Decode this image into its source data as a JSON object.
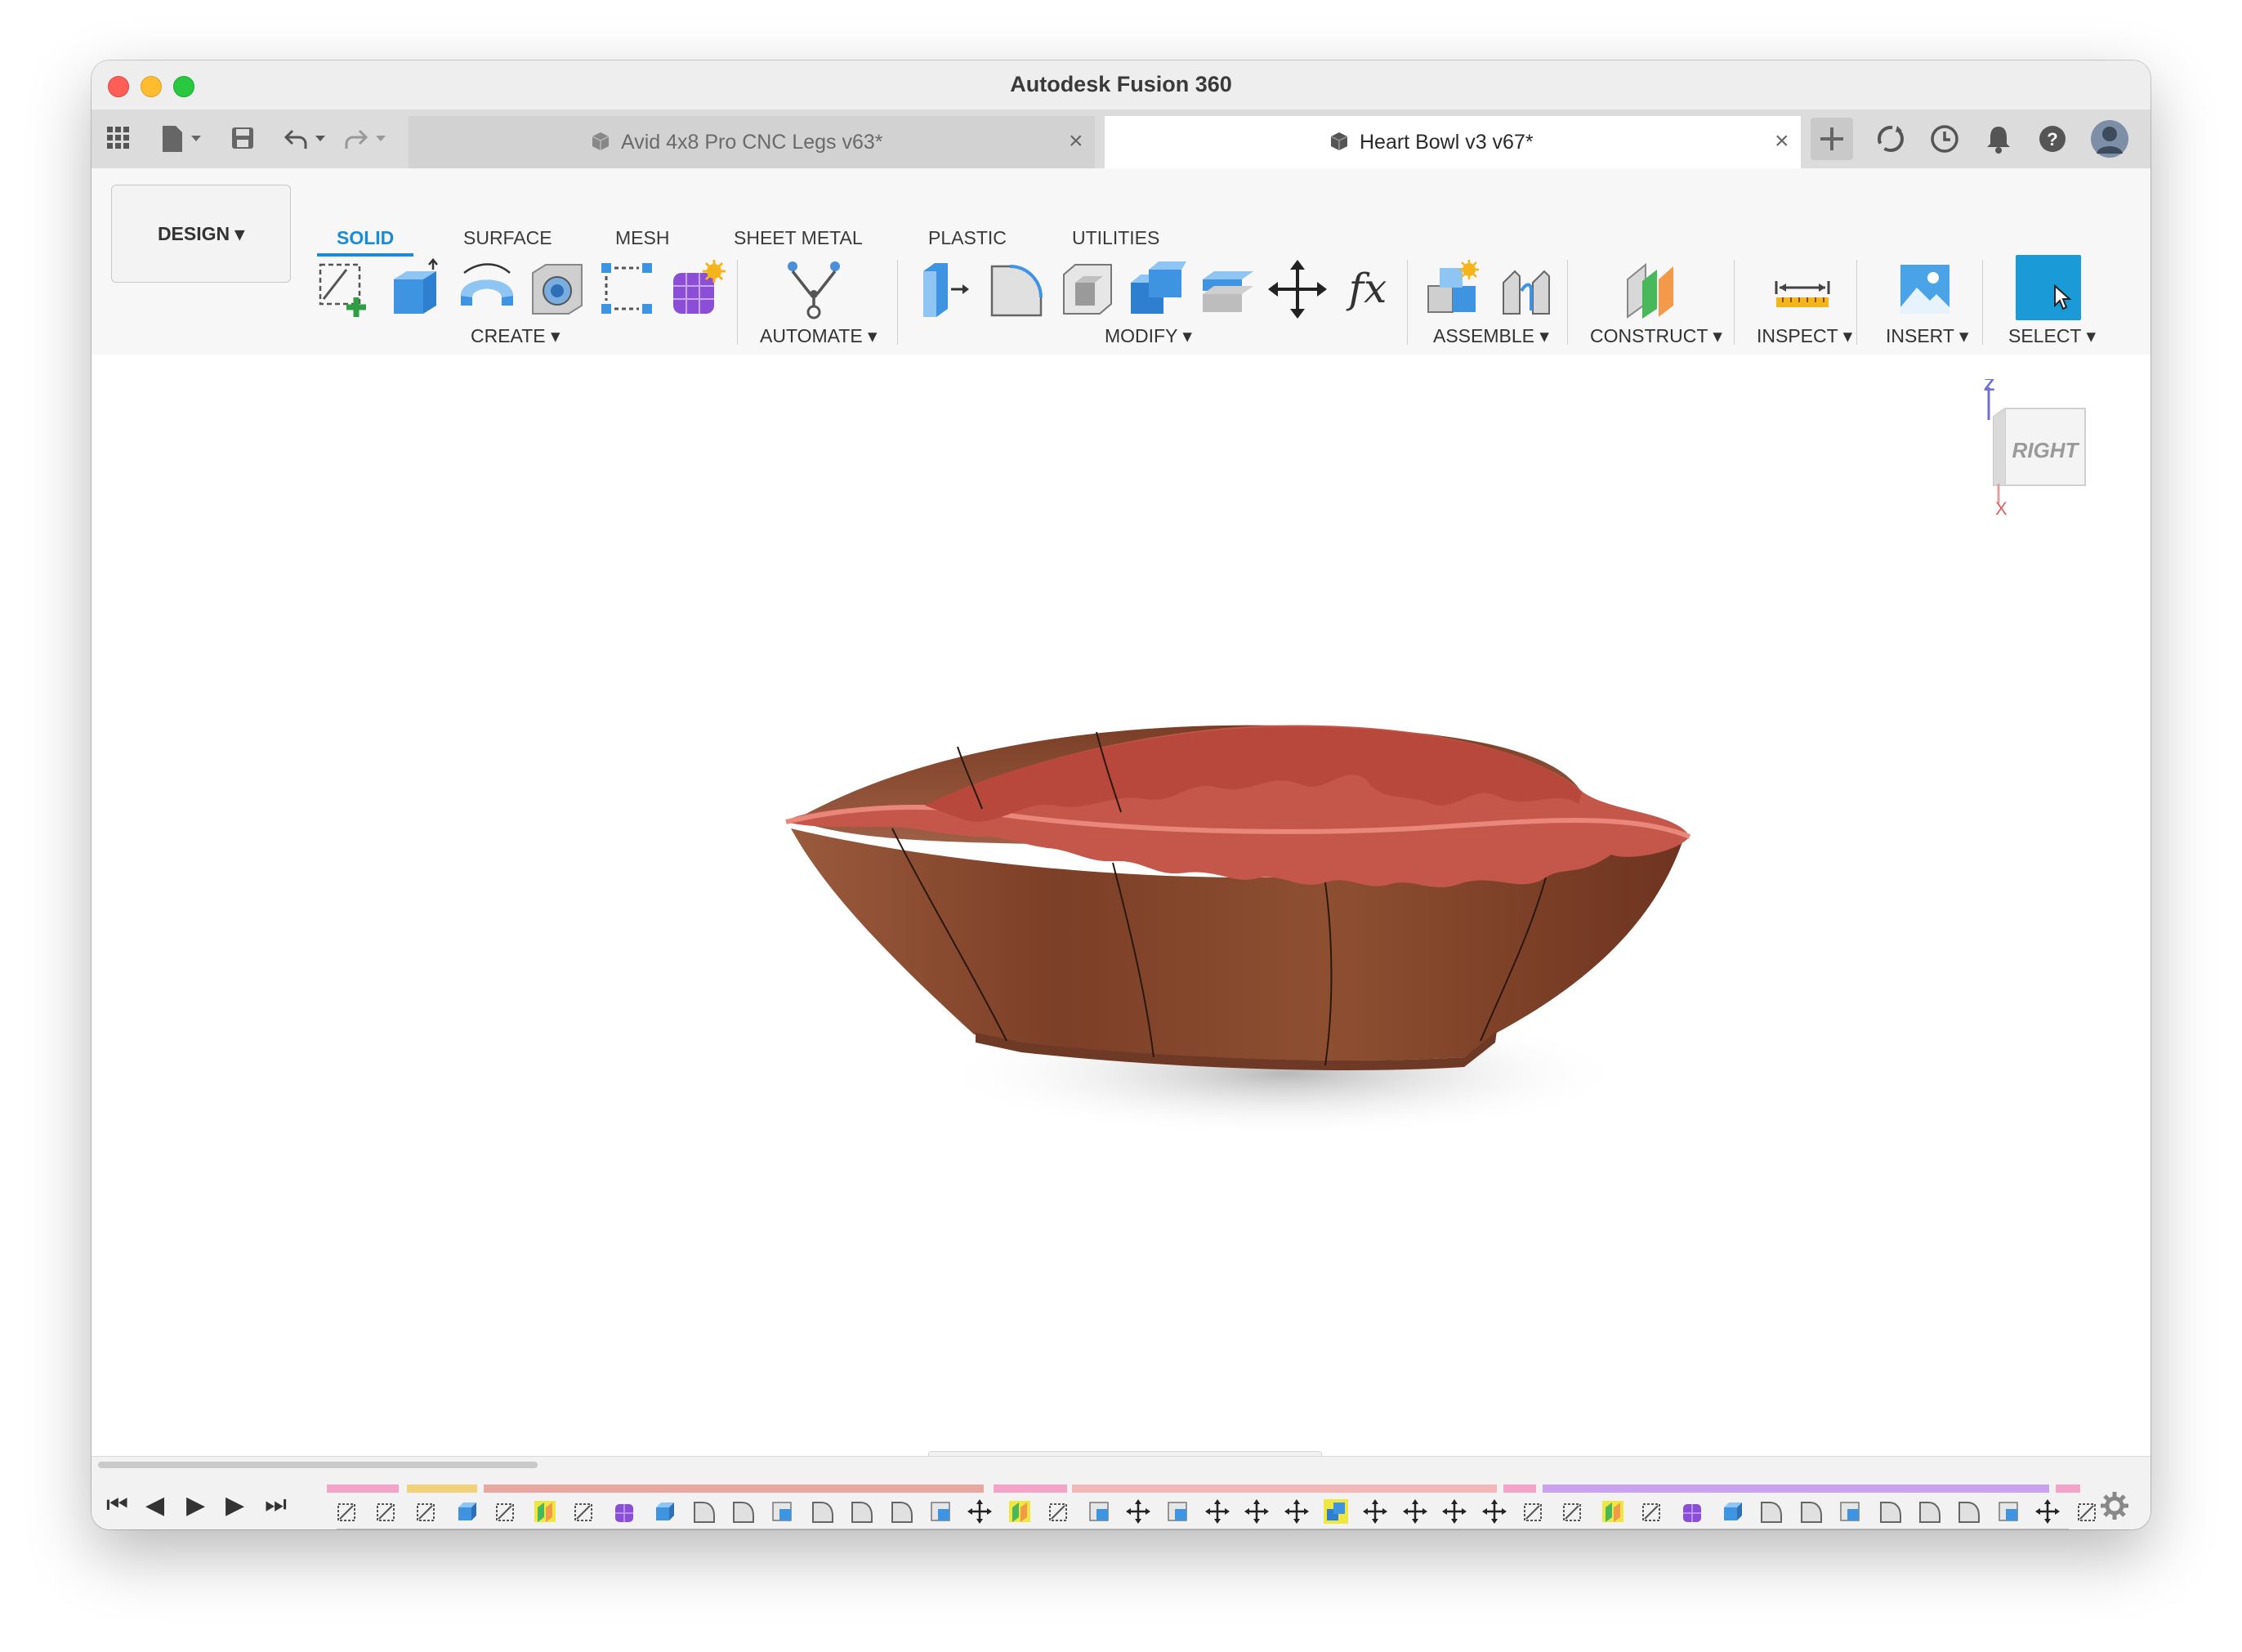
{
  "window": {
    "title": "Autodesk Fusion 360"
  },
  "tabs": [
    {
      "label": "Avid 4x8 Pro CNC Legs v63*",
      "active": false,
      "close": "×"
    },
    {
      "label": "Heart Bowl v3 v67*",
      "active": true,
      "close": "×"
    }
  ],
  "quick_access": {
    "grid_icon": "grid-icon",
    "file_icon": "file-icon",
    "save_icon": "save-icon",
    "undo_icon": "undo-icon",
    "redo_icon": "redo-icon",
    "caret": "▾"
  },
  "right_icons": [
    "new-tab-icon",
    "sync-icon",
    "history-icon",
    "notifications-icon",
    "help-icon",
    "avatar"
  ],
  "workspace": {
    "label": "DESIGN ▾"
  },
  "workspace_tabs": [
    "SOLID",
    "SURFACE",
    "MESH",
    "SHEET METAL",
    "PLASTIC",
    "UTILITIES"
  ],
  "tool_groups": [
    {
      "label": "CREATE ▾"
    },
    {
      "label": "AUTOMATE ▾"
    },
    {
      "label": "MODIFY ▾"
    },
    {
      "label": "ASSEMBLE ▾"
    },
    {
      "label": "CONSTRUCT ▾"
    },
    {
      "label": "INSPECT ▾"
    },
    {
      "label": "INSERT ▾"
    },
    {
      "label": "SELECT ▾"
    }
  ],
  "tools": {
    "create": [
      "create-sketch-icon",
      "extrude-icon",
      "revolve-icon",
      "hole-icon",
      "pattern-icon",
      "create-form-icon"
    ],
    "automate": [
      "automate-icon"
    ],
    "modify": [
      "press-pull-icon",
      "fillet-icon",
      "shell-icon",
      "combine-icon",
      "offset-face-icon",
      "move-icon",
      "parameters-icon"
    ],
    "assemble": [
      "new-component-icon",
      "joint-icon"
    ],
    "construct": [
      "offset-plane-icon"
    ],
    "inspect": [
      "measure-icon"
    ],
    "insert": [
      "insert-image-icon"
    ],
    "select": [
      "select-icon"
    ]
  },
  "fx_label": "fx",
  "viewcube": {
    "face": "RIGHT",
    "z_axis": "Z",
    "x_axis": "X"
  },
  "colors": {
    "accent": "#1a8bd6",
    "bowl_rim": "#c4574a",
    "bowl_wood": "#8a4a30",
    "select_blue": "#1a9ad6"
  },
  "timeline": {
    "playback": [
      "⏮",
      "◀",
      "▶",
      "▶",
      "⏭"
    ],
    "features": [
      "sketch",
      "sketch",
      "sketch",
      "extrude",
      "sketch",
      "plane",
      "sketch",
      "form",
      "extrude",
      "fillet",
      "fillet",
      "shell",
      "fillet",
      "fillet",
      "fillet",
      "shell",
      "move",
      "plane",
      "sketch",
      "shell",
      "move",
      "shell",
      "move",
      "move",
      "move",
      "combine",
      "move",
      "move",
      "move",
      "move",
      "sketch",
      "sketch",
      "plane",
      "sketch",
      "form",
      "extrude",
      "fillet",
      "fillet",
      "shell",
      "fillet",
      "fillet",
      "fillet",
      "shell",
      "move",
      "sketch"
    ]
  }
}
